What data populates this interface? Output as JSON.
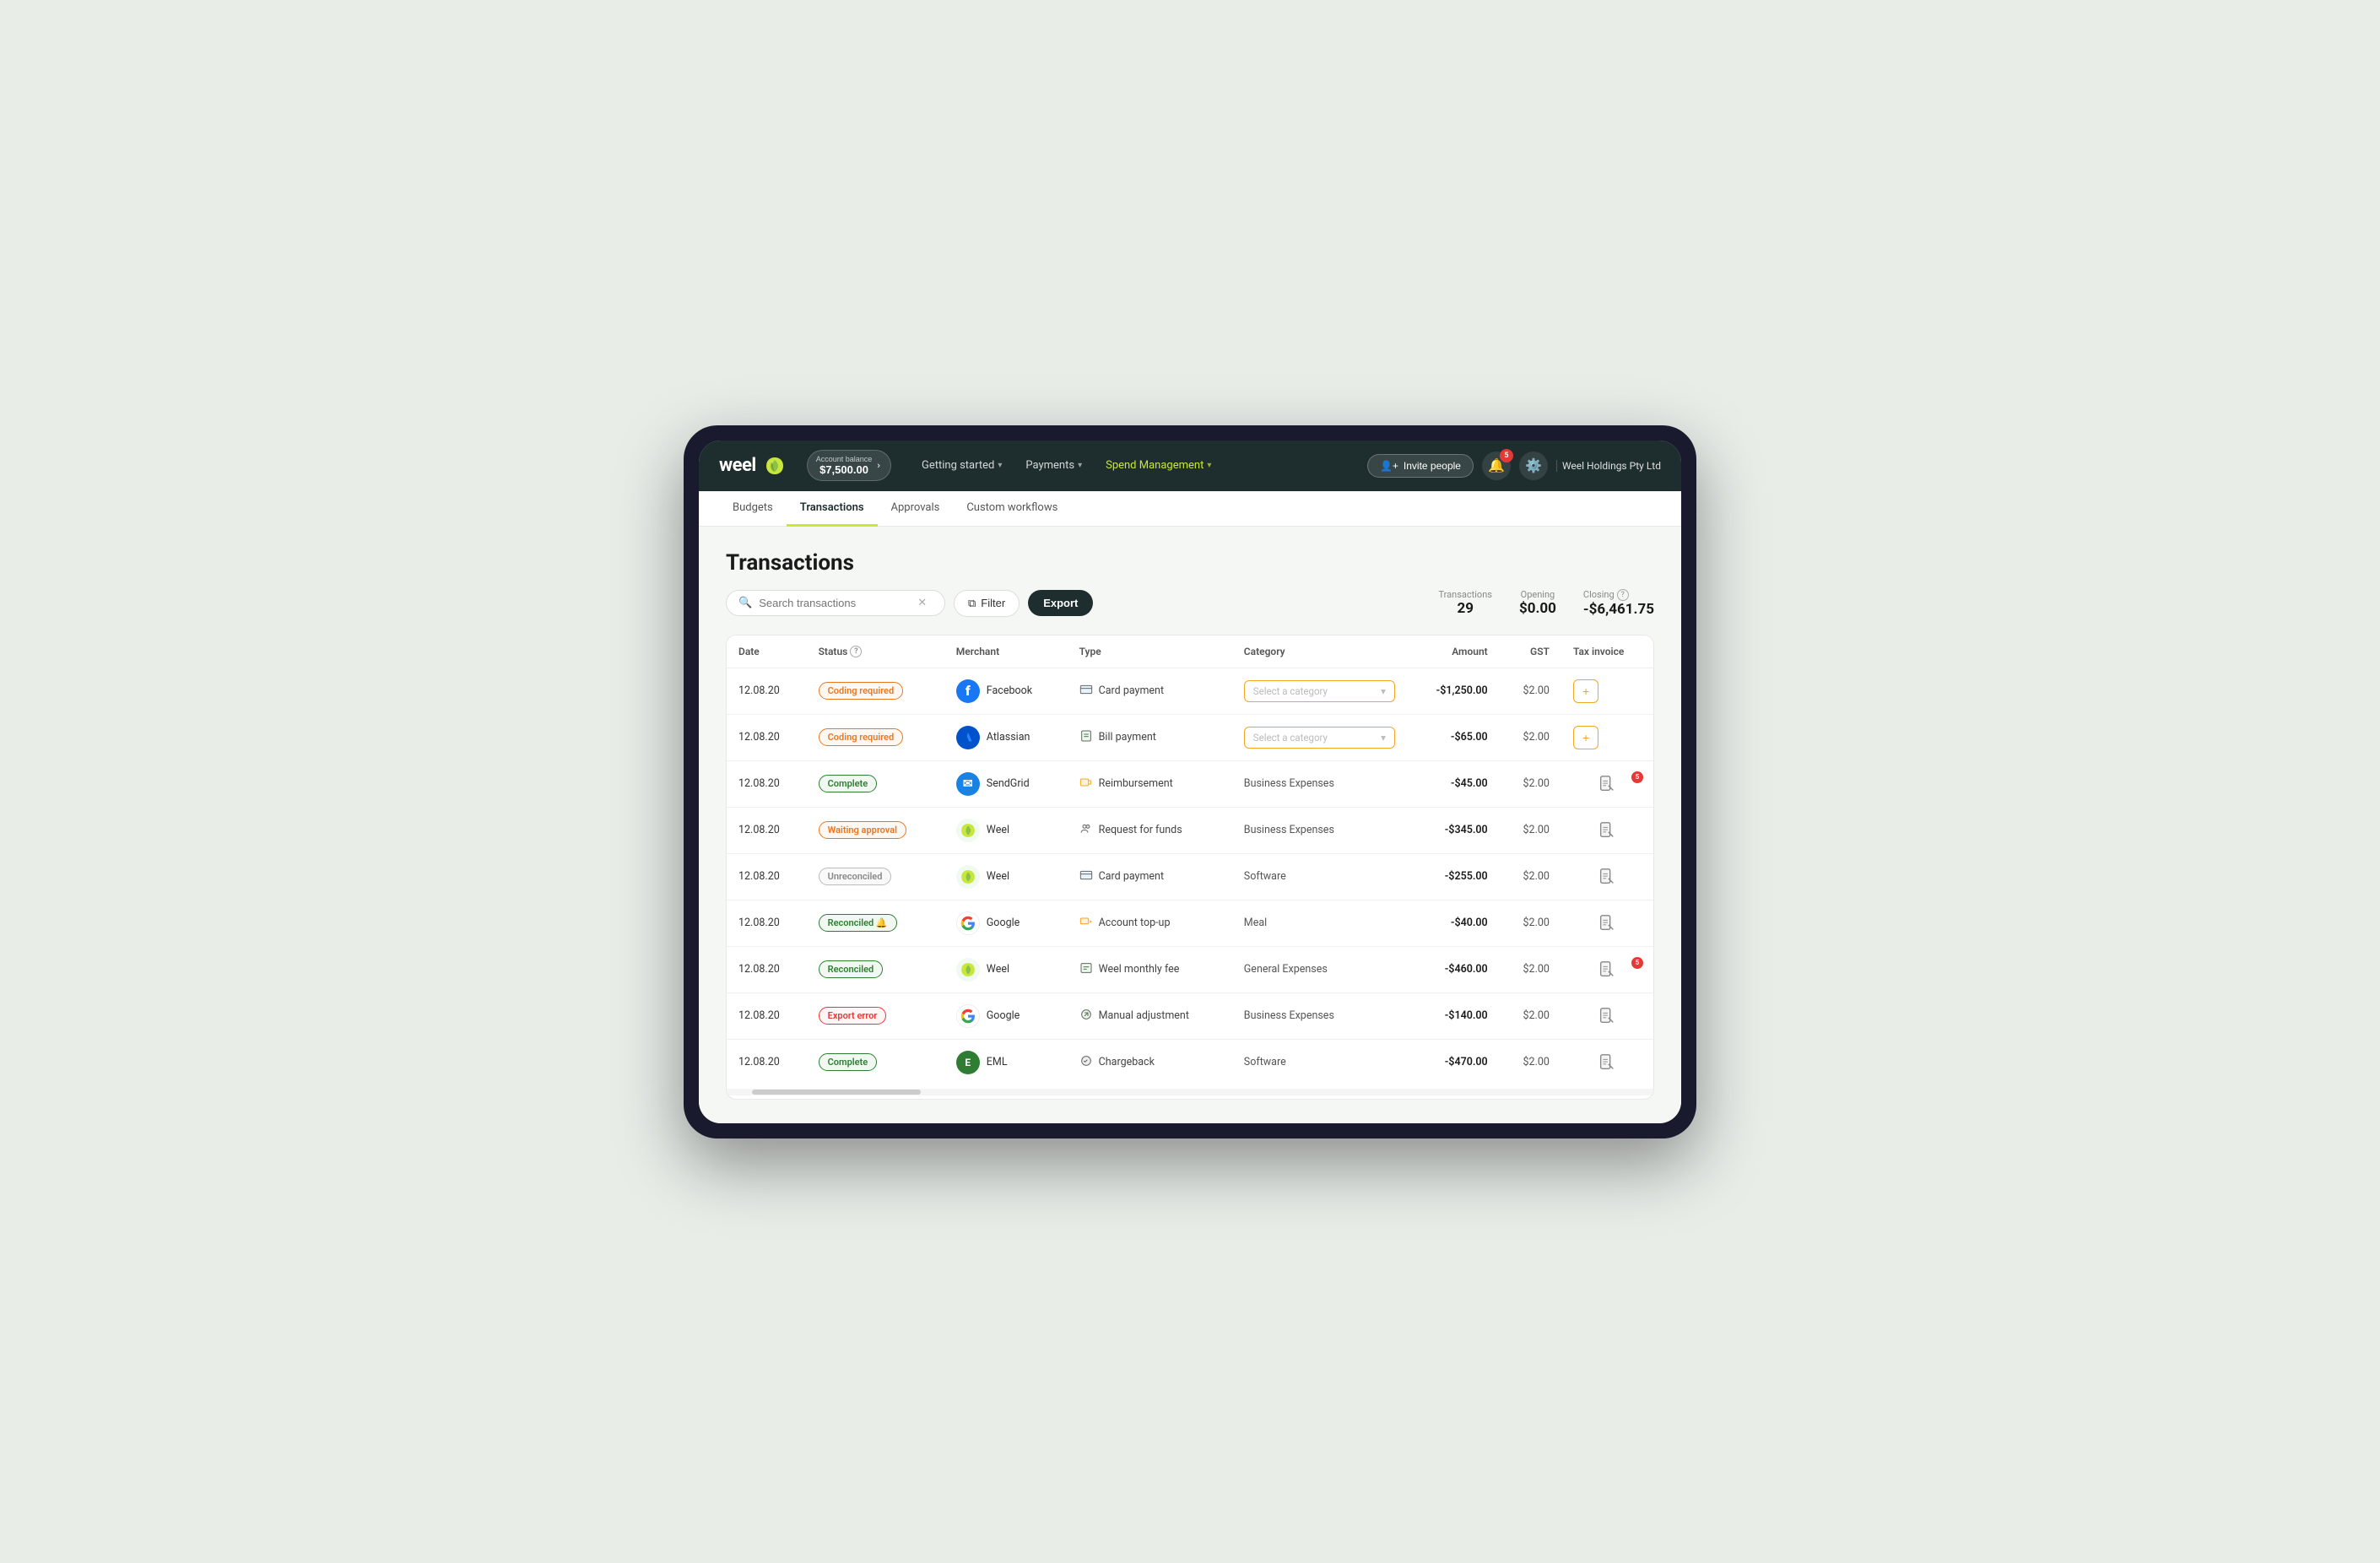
{
  "nav": {
    "logo_text": "weel",
    "account_balance_label": "Account balance",
    "account_balance": "$7,500.00",
    "links": [
      {
        "label": "Getting started",
        "has_dropdown": true,
        "active": false
      },
      {
        "label": "Payments",
        "has_dropdown": true,
        "active": false
      },
      {
        "label": "Spend Management",
        "has_dropdown": true,
        "active": true
      }
    ],
    "invite_btn": "Invite people",
    "notification_count": "5",
    "company": "Weel Holdings Pty Ltd"
  },
  "sub_nav": {
    "items": [
      {
        "label": "Budgets",
        "active": false
      },
      {
        "label": "Transactions",
        "active": true
      },
      {
        "label": "Approvals",
        "active": false
      },
      {
        "label": "Custom workflows",
        "active": false
      }
    ]
  },
  "page": {
    "title": "Transactions",
    "search_placeholder": "Search transactions",
    "filter_label": "Filter",
    "export_label": "Export",
    "stats": {
      "transactions_label": "Transactions",
      "transactions_value": "29",
      "opening_label": "Opening",
      "opening_value": "$0.00",
      "closing_label": "Closing",
      "closing_value": "-$6,461.75"
    }
  },
  "table": {
    "headers": [
      "Date",
      "Status",
      "Merchant",
      "Type",
      "Category",
      "Amount",
      "GST",
      "Tax invoice"
    ],
    "rows": [
      {
        "date": "12.08.20",
        "status": "Coding required",
        "status_type": "coding",
        "merchant": "Facebook",
        "merchant_type": "fb",
        "type": "Card payment",
        "type_icon": "💳",
        "category": "Select a category",
        "category_editable": true,
        "amount": "-$1,250.00",
        "gst": "$2.00",
        "tax_invoice": "add",
        "receipt_badge": null
      },
      {
        "date": "12.08.20",
        "status": "Coding required",
        "status_type": "coding",
        "merchant": "Atlassian",
        "merchant_type": "atlassian",
        "type": "Bill payment",
        "type_icon": "🧾",
        "category": "Select a category",
        "category_editable": true,
        "amount": "-$65.00",
        "gst": "$2.00",
        "tax_invoice": "add",
        "receipt_badge": null
      },
      {
        "date": "12.08.20",
        "status": "Complete",
        "status_type": "complete",
        "merchant": "SendGrid",
        "merchant_type": "sendgrid",
        "type": "Reimbursement",
        "type_icon": "🔶",
        "category": "Business Expenses",
        "category_editable": false,
        "amount": "-$45.00",
        "gst": "$2.00",
        "tax_invoice": "receipt",
        "receipt_badge": "5"
      },
      {
        "date": "12.08.20",
        "status": "Waiting approval",
        "status_type": "waiting",
        "merchant": "Weel",
        "merchant_type": "weel",
        "type": "Request for funds",
        "type_icon": "👥",
        "category": "Business Expenses",
        "category_editable": false,
        "amount": "-$345.00",
        "gst": "$2.00",
        "tax_invoice": "receipt",
        "receipt_badge": null
      },
      {
        "date": "12.08.20",
        "status": "Unreconciled",
        "status_type": "unreconciled",
        "merchant": "Weel",
        "merchant_type": "weel",
        "type": "Card payment",
        "type_icon": "💳",
        "category": "Software",
        "category_editable": false,
        "amount": "-$255.00",
        "gst": "$2.00",
        "tax_invoice": "receipt",
        "receipt_badge": null
      },
      {
        "date": "12.08.20",
        "status": "Reconciled",
        "status_type": "reconciled-bell",
        "merchant": "Google",
        "merchant_type": "google",
        "type": "Account top-up",
        "type_icon": "🟧",
        "category": "Meal",
        "category_editable": false,
        "amount": "-$40.00",
        "gst": "$2.00",
        "tax_invoice": "receipt",
        "receipt_badge": null
      },
      {
        "date": "12.08.20",
        "status": "Reconciled",
        "status_type": "reconciled",
        "merchant": "Weel",
        "merchant_type": "weel",
        "type": "Weel monthly fee",
        "type_icon": "📋",
        "category": "General Expenses",
        "category_editable": false,
        "amount": "-$460.00",
        "gst": "$2.00",
        "tax_invoice": "receipt",
        "receipt_badge": "5"
      },
      {
        "date": "12.08.20",
        "status": "Export error",
        "status_type": "export-error",
        "merchant": "Google",
        "merchant_type": "google",
        "type": "Manual adjustment",
        "type_icon": "🔧",
        "category": "Business Expenses",
        "category_editable": false,
        "amount": "-$140.00",
        "gst": "$2.00",
        "tax_invoice": "receipt",
        "receipt_badge": null
      },
      {
        "date": "12.08.20",
        "status": "Complete",
        "status_type": "complete",
        "merchant": "EML",
        "merchant_type": "eml",
        "type": "Chargeback",
        "type_icon": "🔄",
        "category": "Software",
        "category_editable": false,
        "amount": "-$470.00",
        "gst": "$2.00",
        "tax_invoice": "receipt",
        "receipt_badge": null
      }
    ]
  }
}
